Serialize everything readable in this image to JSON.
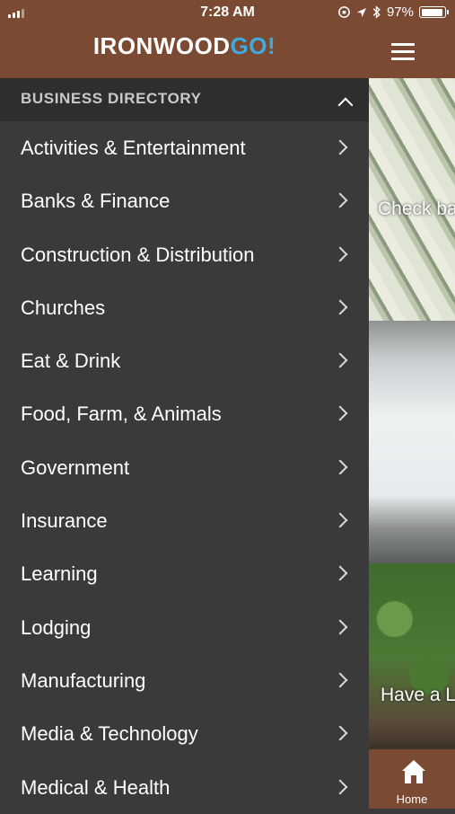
{
  "status": {
    "time": "7:28 AM",
    "battery": "97%"
  },
  "header": {
    "logo_part1": "IRONWOOD",
    "logo_part2": "GO!"
  },
  "drawer": {
    "section_title": "BUSINESS DIRECTORY",
    "items": [
      {
        "label": "Activities & Entertainment"
      },
      {
        "label": "Banks & Finance"
      },
      {
        "label": "Construction & Distribution"
      },
      {
        "label": "Churches"
      },
      {
        "label": "Eat & Drink"
      },
      {
        "label": "Food, Farm, & Animals"
      },
      {
        "label": "Government"
      },
      {
        "label": "Insurance"
      },
      {
        "label": "Learning"
      },
      {
        "label": "Lodging"
      },
      {
        "label": "Manufacturing"
      },
      {
        "label": "Media & Technology"
      },
      {
        "label": "Medical & Health"
      }
    ]
  },
  "content": {
    "card1_caption": "Check ba",
    "card3_caption": "Have a L"
  },
  "tabbar": {
    "home_label": "Home"
  },
  "colors": {
    "brand": "#7b4a33",
    "accent": "#3fa9e0",
    "drawer_bg": "#3a3a3a"
  }
}
